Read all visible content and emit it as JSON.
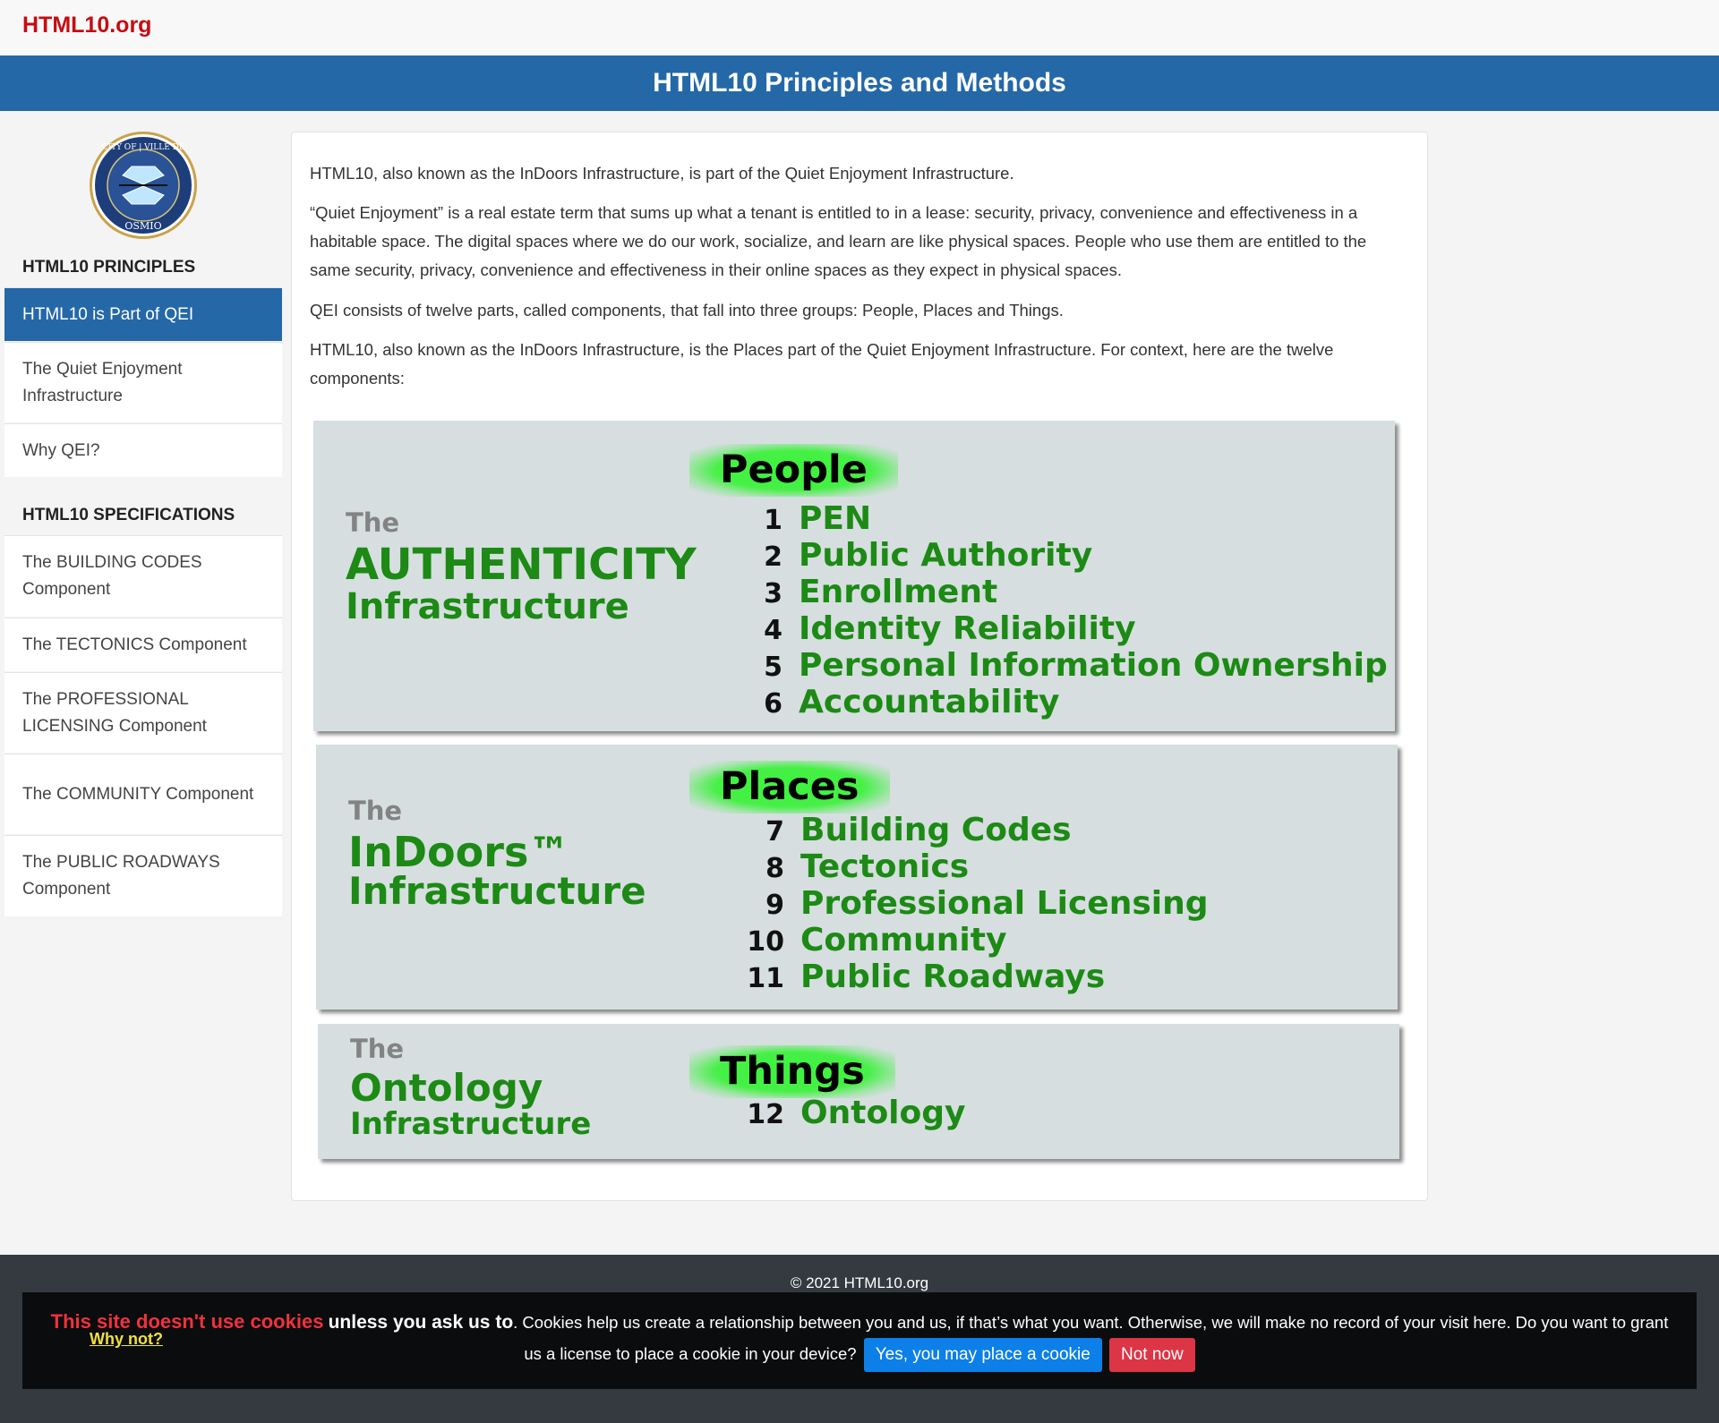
{
  "brand": "HTML10.org",
  "page_title": "HTML10 Principles and Methods",
  "sidebar": {
    "seal_text_top": "CITY OF | VILLE DE",
    "seal_text_bottom": "OSMIO",
    "principles_heading": "HTML10 PRINCIPLES",
    "principles": [
      {
        "label": "HTML10 is Part of QEI"
      },
      {
        "label": "The Quiet Enjoyment Infrastructure"
      },
      {
        "label": "Why QEI?"
      }
    ],
    "specs_heading": "HTML10 SPECIFICATIONS",
    "specs": [
      {
        "label": "The BUILDING CODES Component"
      },
      {
        "label": "The TECTONICS Component"
      },
      {
        "label": "The PROFESSIONAL LICENSING Component"
      },
      {
        "label": "The COMMUNITY Component"
      },
      {
        "label": "The PUBLIC ROADWAYS Component"
      }
    ]
  },
  "main": {
    "paragraphs": [
      "HTML10, also known as the InDoors Infrastructure, is part of the Quiet Enjoyment Infrastructure.",
      "“Quiet Enjoyment” is a real estate term that sums up what a tenant is entitled to in a lease: security, privacy, convenience and effectiveness in a habitable space. The digital spaces where we do our work, socialize, and learn are like physical spaces. People who use them are entitled to the same security, privacy, convenience and effectiveness in their online spaces as they expect in physical spaces.",
      "QEI consists of twelve parts, called components, that fall into three groups: People, Places and Things.",
      "HTML10, also known as the InDoors Infrastructure, is the Places part of the Quiet Enjoyment Infrastructure. For context, here are the twelve components:"
    ]
  },
  "diagram": {
    "groups": [
      {
        "the": "The",
        "name1": "AUTHENTICITY",
        "name2": "Infrastructure",
        "title": "People",
        "components": [
          {
            "num": "1",
            "name": "PEN"
          },
          {
            "num": "2",
            "name": "Public Authority"
          },
          {
            "num": "3",
            "name": "Enrollment"
          },
          {
            "num": "4",
            "name": "Identity Reliability"
          },
          {
            "num": "5",
            "name": "Personal Information Ownership"
          },
          {
            "num": "6",
            "name": "Accountability"
          }
        ]
      },
      {
        "the": "The",
        "name1": "InDoors™",
        "name2": "Infrastructure",
        "title": "Places",
        "components": [
          {
            "num": "7",
            "name": "Building Codes"
          },
          {
            "num": "8",
            "name": "Tectonics"
          },
          {
            "num": "9",
            "name": "Professional Licensing"
          },
          {
            "num": "10",
            "name": "Community"
          },
          {
            "num": "11",
            "name": "Public Roadways"
          }
        ]
      },
      {
        "the": "The",
        "name1": "Ontology",
        "name2": "Infrastructure",
        "title": "Things",
        "components": [
          {
            "num": "12",
            "name": "Ontology"
          }
        ]
      }
    ]
  },
  "footer": {
    "copyright": "© 2021 HTML10.org",
    "cookie_red": "This site doesn't use cookies",
    "cookie_bold": "unless you ask us to",
    "cookie_text": ". Cookies help us create a relationship between you and us, if that’s what you want. Otherwise, we will make no record of your visit here. Do you want to grant us a license to place a cookie in your device?",
    "why_not": "Why not?",
    "accept_label": "Yes, you may place a cookie",
    "decline_label": "Not now"
  },
  "colors": {
    "brand": "#c40d12",
    "primary": "#2468a8",
    "diagram_green": "#1c8a14",
    "glow_green": "#3df23d",
    "accept": "#0d7fe8",
    "decline": "#dc3545"
  }
}
